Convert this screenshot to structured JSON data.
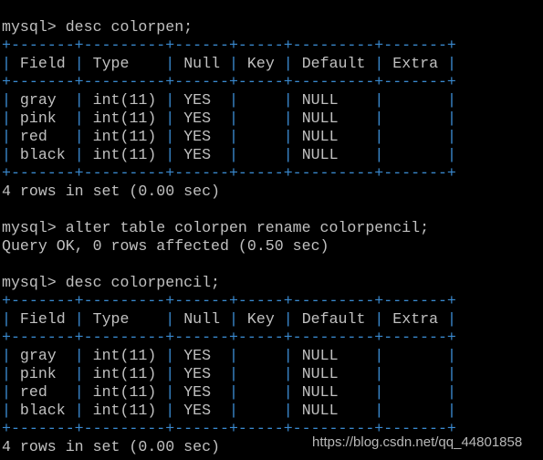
{
  "prompt": "mysql> ",
  "colors": {
    "text": "#c0c0c0",
    "border": "#3a8ad0",
    "background": "#000000"
  },
  "columns": [
    "Field",
    "Type",
    "Null",
    "Key",
    "Default",
    "Extra"
  ],
  "blocks": [
    {
      "command": "desc colorpen;",
      "table": [
        [
          "gray",
          "int(11)",
          "YES",
          "",
          "NULL",
          ""
        ],
        [
          "pink",
          "int(11)",
          "YES",
          "",
          "NULL",
          ""
        ],
        [
          "red",
          "int(11)",
          "YES",
          "",
          "NULL",
          ""
        ],
        [
          "black",
          "int(11)",
          "YES",
          "",
          "NULL",
          ""
        ]
      ],
      "result": "4 rows in set (0.00 sec)"
    },
    {
      "command": "alter table colorpen rename colorpencil;",
      "result": "Query OK, 0 rows affected (0.50 sec)"
    },
    {
      "command": "desc colorpencil;",
      "table": [
        [
          "gray",
          "int(11)",
          "YES",
          "",
          "NULL",
          ""
        ],
        [
          "pink",
          "int(11)",
          "YES",
          "",
          "NULL",
          ""
        ],
        [
          "red",
          "int(11)",
          "YES",
          "",
          "NULL",
          ""
        ],
        [
          "black",
          "int(11)",
          "YES",
          "",
          "NULL",
          ""
        ]
      ],
      "result": "4 rows in set (0.00 sec)"
    }
  ],
  "watermark": "https://blog.csdn.net/qq_44801858"
}
